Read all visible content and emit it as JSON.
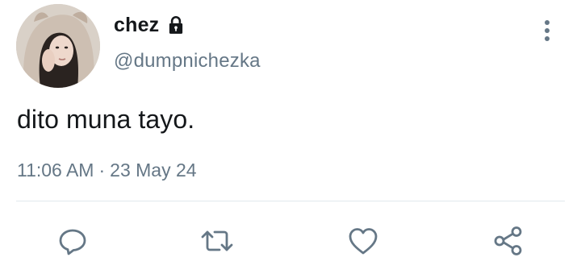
{
  "author": {
    "display_name": "chez",
    "handle": "@dumpnichezka",
    "protected": true
  },
  "tweet": {
    "text": "dito muna tayo.",
    "time": "11:06 AM",
    "separator": "·",
    "date": "23 May 24"
  },
  "icons": {
    "lock": "lock-icon",
    "more": "more-vertical-icon",
    "reply": "reply-icon",
    "retweet": "retweet-icon",
    "like": "heart-icon",
    "share": "share-icon"
  },
  "colors": {
    "text_primary": "#14171a",
    "text_secondary": "#657786",
    "divider": "#e1e8ed"
  }
}
